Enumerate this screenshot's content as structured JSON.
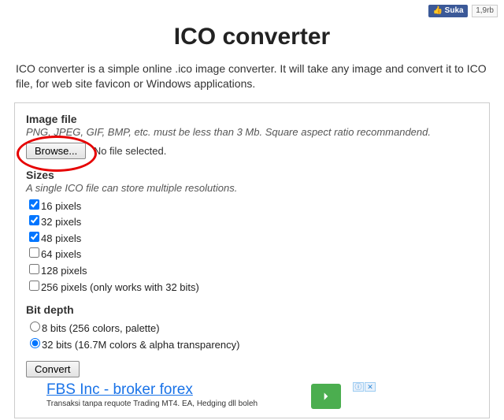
{
  "social": {
    "like_label": "Suka",
    "like_count": "1,9rb"
  },
  "title": "ICO converter",
  "intro": "ICO converter is a simple online .ico image converter. It will take any image and convert it to ICO file, for web site favicon or Windows applications.",
  "sections": {
    "image_file": {
      "heading": "Image file",
      "hint": "PNG, JPEG, GIF, BMP, etc. must be less than 3 Mb. Square aspect ratio recommandend.",
      "browse_label": "Browse...",
      "file_status": "No file selected."
    },
    "sizes": {
      "heading": "Sizes",
      "hint": "A single ICO file can store multiple resolutions.",
      "options": [
        {
          "label": "16 pixels",
          "checked": true
        },
        {
          "label": "32 pixels",
          "checked": true
        },
        {
          "label": "48 pixels",
          "checked": true
        },
        {
          "label": "64 pixels",
          "checked": false
        },
        {
          "label": "128 pixels",
          "checked": false
        },
        {
          "label": "256 pixels (only works with 32 bits)",
          "checked": false
        }
      ]
    },
    "bitdepth": {
      "heading": "Bit depth",
      "options": [
        {
          "label": "8 bits (256 colors, palette)",
          "checked": false
        },
        {
          "label": "32 bits (16.7M colors & alpha transparency)",
          "checked": true
        }
      ]
    },
    "convert_label": "Convert"
  },
  "ad": {
    "title": "FBS Inc - broker forex",
    "subtitle": "Transaksi tanpa requote Trading MT4. EA, Hedging dll boleh"
  }
}
